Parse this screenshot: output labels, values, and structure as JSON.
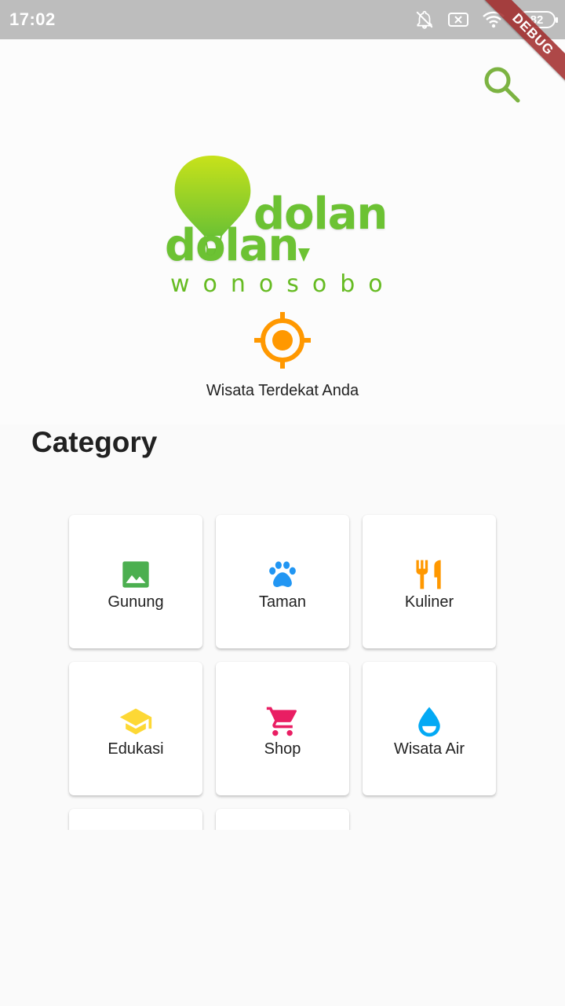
{
  "status_bar": {
    "time": "17:02",
    "battery": "82",
    "icons": [
      "bell-off-icon",
      "sim-off-icon",
      "wifi-icon",
      "battery-icon"
    ]
  },
  "debug_banner": "DEBUG",
  "header": {
    "logo": {
      "word_top": "dolan",
      "word_bottom": "dolan",
      "subtitle": "wonosobo"
    },
    "search_icon": "search-icon",
    "nearby_label": "Wisata Terdekat Anda"
  },
  "category": {
    "title": "Category",
    "items": [
      {
        "label": "Gunung",
        "icon": "image-icon",
        "color": "#4caf50"
      },
      {
        "label": "Taman",
        "icon": "paw-icon",
        "color": "#2196f3"
      },
      {
        "label": "Kuliner",
        "icon": "restaurant-icon",
        "color": "#ff9800"
      },
      {
        "label": "Edukasi",
        "icon": "school-icon",
        "color": "#ffeb3b"
      },
      {
        "label": "Shop",
        "icon": "cart-icon",
        "color": "#e91e63"
      },
      {
        "label": "Wisata Air",
        "icon": "water-drop-icon",
        "color": "#03a9f4"
      },
      {
        "label": "",
        "icon": "",
        "color": ""
      },
      {
        "label": "",
        "icon": "",
        "color": ""
      }
    ]
  },
  "colors": {
    "accent_green": "#6cc233",
    "accent_orange": "#ff9800",
    "status_bar": "#bdbdbd"
  }
}
